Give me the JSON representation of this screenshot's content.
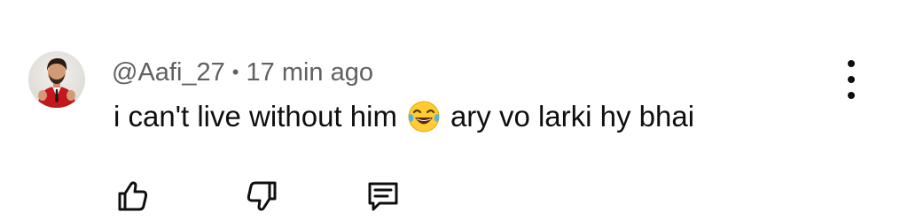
{
  "comment": {
    "author": "@Aafi_27",
    "separator": "•",
    "time": "17 min ago",
    "text_before": "i can't live without him",
    "emoji": "face-with-tears-of-joy",
    "text_after": "ary vo larki hy bhai"
  },
  "icons": {
    "more": "more-vertical-icon",
    "like": "thumbs-up-icon",
    "dislike": "thumbs-down-icon",
    "reply": "comment-reply-icon"
  },
  "colors": {
    "text": "#0f0f0f",
    "meta": "#606060",
    "avatar_jacket": "#c4161c"
  }
}
